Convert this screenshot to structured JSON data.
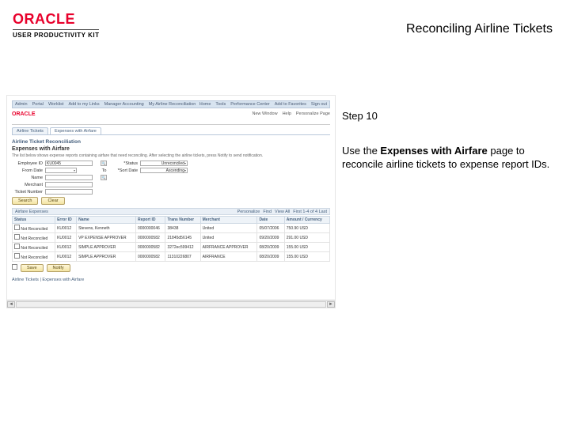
{
  "header": {
    "logo_text": "ORACLE",
    "logo_subtitle": "USER PRODUCTIVITY KIT",
    "page_title": "Reconciling Airline Tickets"
  },
  "instructions": {
    "step_label": "Step 10",
    "sentence_pre": "Use the ",
    "sentence_bold": "Expenses with Airfare",
    "sentence_post": " page to reconcile airline tickets to expense report IDs."
  },
  "screenshot": {
    "navbar_left": [
      "Admin",
      "Portal",
      "Worklist",
      "Add to my Links",
      "Manager Accounting",
      "My Airline Reconciliation"
    ],
    "navbar_right": [
      "Home",
      "Tools",
      "Performance Center",
      "Add to Favorites",
      "Sign out"
    ],
    "mini_logo": "ORACLE",
    "mini_links": [
      "New Window",
      "Help",
      "Personalize Page"
    ],
    "tabs": [
      "Airline Tickets",
      "Expenses with Airfare"
    ],
    "section_title": "Airline Ticket Reconciliation",
    "page_heading": "Expenses with Airfare",
    "hint_text": "The list below shows expense reports containing airfare that need reconciling. After selecting the airline tickets, press Notify to send notification.",
    "search": {
      "employee_id_label": "Employee ID",
      "employee_id_value": "KU0045",
      "status_label": "*Status",
      "status_value": "Unreconciled",
      "from_date_label": "From Date",
      "to_label": "To",
      "sort_date_label": "*Sort Date",
      "sort_date_value": "Ascending",
      "name_label": "Name",
      "merchant_label": "Merchant",
      "ticket_label": "Ticket Number"
    },
    "buttons": {
      "search": "Search",
      "clear": "Clear"
    },
    "results_caption": "Airfare Expenses",
    "pager": {
      "personalize": "Personalize",
      "find": "Find",
      "viewall": "View All",
      "range": "First 1-4 of 4 Last"
    },
    "columns": [
      "Status",
      "Error ID",
      "Name",
      "Report ID",
      "Trans Number",
      "Merchant",
      "Date",
      "Amount / Currency"
    ],
    "rows": [
      {
        "status": "Not Reconciled",
        "error": "KU0012",
        "name": "Stevens, Kenneth",
        "report": "0000000046",
        "trans": "38438",
        "merchant": "United",
        "date": "05/07/2006",
        "amount": "750.90 USD"
      },
      {
        "status": "Not Reconciled",
        "error": "KU0012",
        "name": "VP EXPENSE APPROVER",
        "report": "0000000582",
        "trans": "21845d56145",
        "merchant": "United",
        "date": "09/20/2009",
        "amount": "291.00 USD"
      },
      {
        "status": "Not Reconciled",
        "error": "KU0012",
        "name": "SIMPLE APPROVER",
        "report": "0000000582",
        "trans": "3272ec599412",
        "merchant": "AIRFRANCE APPROVER",
        "date": "08/20/2009",
        "amount": "155.00 USD"
      },
      {
        "status": "Not Reconciled",
        "error": "KU0012",
        "name": "SIMPLE APPROVER",
        "report": "0000000582",
        "trans": "11310226807",
        "merchant": "AIRFRANCE",
        "date": "08/20/2009",
        "amount": "155.00 USD"
      }
    ],
    "action_buttons": {
      "save": "Save",
      "notify": "Notify"
    },
    "bottom_link": "Airline Tickets | Expenses with Airfare"
  }
}
